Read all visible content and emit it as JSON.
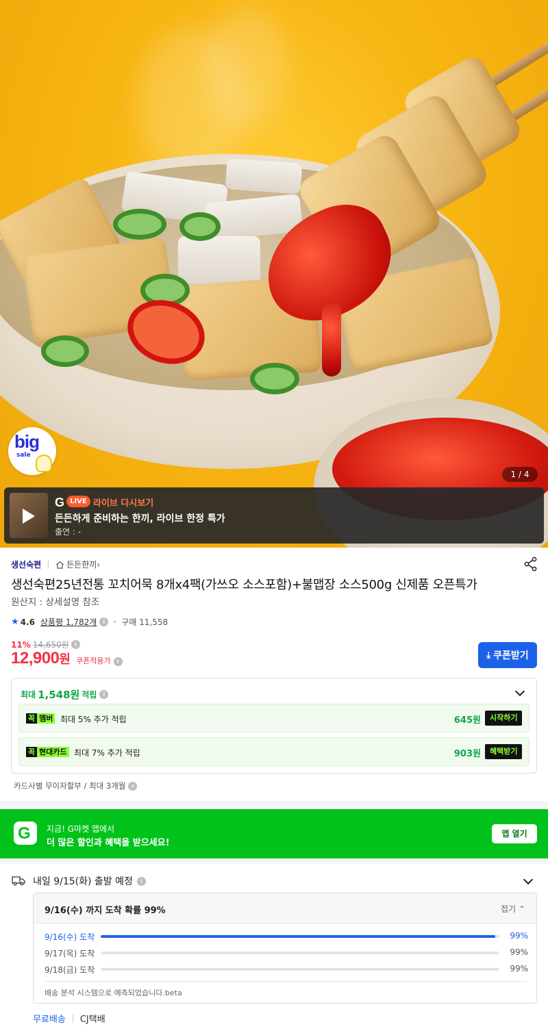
{
  "hero": {
    "badge_big": "big",
    "badge_sale": "sale",
    "page_indicator": "1 / 4"
  },
  "live": {
    "logo": "G",
    "pill": "LIVE",
    "title": "라이브 다시보기",
    "desc": "든든하게 준비하는 한끼, 라이브 한정 특가",
    "host": "출연 : -"
  },
  "product": {
    "brand": "생선숙편",
    "shop": "든든한끼",
    "shop_chevron": "›",
    "title": "생선숙편25년전통 꼬치어묵 8개x4팩(가쓰오 소스포함)+불맵장 소스500g 신제품 오픈특가",
    "origin": "원산지 : 상세설명 참조",
    "rating": "4.6",
    "review_label": "상품평",
    "review_count": "1,782개",
    "buy_count": "구매 11,558",
    "discount": "11%",
    "original_price": "14,650원",
    "price": "12,900",
    "price_unit": "원",
    "coupon_applied": "쿠폰적용가",
    "coupon_button": "쿠폰받기"
  },
  "reward": {
    "prefix": "최대",
    "amount": "1,548원",
    "suffix": "적립",
    "items": [
      {
        "tag_k": "꼭",
        "tag_n": "멤버",
        "desc": "최대 5% 추가 적립",
        "amount": "645원",
        "button": "시작하기"
      },
      {
        "tag_k": "꼭",
        "tag_n": "현대카드",
        "desc": "최대 7% 추가 적립",
        "amount": "903원",
        "button": "혜택받기"
      }
    ]
  },
  "installment": "카드사별 무이자할부 / 최대 3개월",
  "app_banner": {
    "line1": "지금! G마켓 앱에서",
    "line2": "더 많은 할인과 혜택을 받으세요!",
    "button": "앱 열기",
    "logo": "G"
  },
  "shipping": {
    "title": "내일 9/15(화) 출발 예정",
    "box_title": "9/16(수) 까지 도착 확률 99%",
    "fold": "접기",
    "rows": [
      {
        "date": "9/16(수) 도착",
        "percent": "99%",
        "fill": 0.99
      },
      {
        "date": "9/17(목) 도착",
        "percent": "99%",
        "fill": 0
      },
      {
        "date": "9/18(금) 도착",
        "percent": "99%",
        "fill": 0
      }
    ],
    "note": "배송 분석 시스템으로 예측되었습니다.beta",
    "free": "무료배송",
    "carrier": "CJ택배"
  },
  "colors": {
    "accent_blue": "#1c62e8",
    "price_red": "#f43142",
    "reward_green": "#11a54b",
    "app_green": "#00c21a"
  },
  "icons": [
    "play-icon",
    "home-icon",
    "share-icon",
    "star-icon",
    "info-icon",
    "chevron-down-icon",
    "download-icon",
    "truck-icon",
    "chevron-up-icon"
  ]
}
